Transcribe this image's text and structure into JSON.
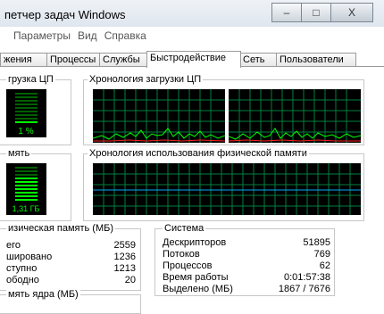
{
  "window": {
    "title": "петчер задач Windows"
  },
  "window_buttons": {
    "minimize": "–",
    "maximize": "□",
    "close": "X"
  },
  "menu": [
    "Параметры",
    "Вид",
    "Справка"
  ],
  "tabs": [
    "жения",
    "Процессы",
    "Службы",
    "Быстродействие",
    "Сеть",
    "Пользователи"
  ],
  "active_tab": "Быстродействие",
  "cpu": {
    "label": "грузка ЦП",
    "value": "1 %",
    "history_label": "Хронология загрузки ЦП",
    "usage_percent": 1
  },
  "memory": {
    "label": "мять",
    "value": "1,31 ГБ",
    "history_label": "Хронология использования физической памяти"
  },
  "phys_mem": {
    "label": "изическая память (МБ)",
    "rows": [
      {
        "label": "его",
        "value": "2559"
      },
      {
        "label": "шировано",
        "value": "1236"
      },
      {
        "label": "ступно",
        "value": "1213"
      },
      {
        "label": "ободно",
        "value": "20"
      }
    ]
  },
  "kernel_mem": {
    "label": "мять ядра (МБ)"
  },
  "system": {
    "label": "Система",
    "rows": [
      {
        "label": "Дескрипторов",
        "value": "51895"
      },
      {
        "label": "Потоков",
        "value": "769"
      },
      {
        "label": "Процессов",
        "value": "62"
      },
      {
        "label": "Время работы",
        "value": "0:01:57:38"
      },
      {
        "label": "Выделено (МБ)",
        "value": "1867 / 7676"
      }
    ]
  }
}
